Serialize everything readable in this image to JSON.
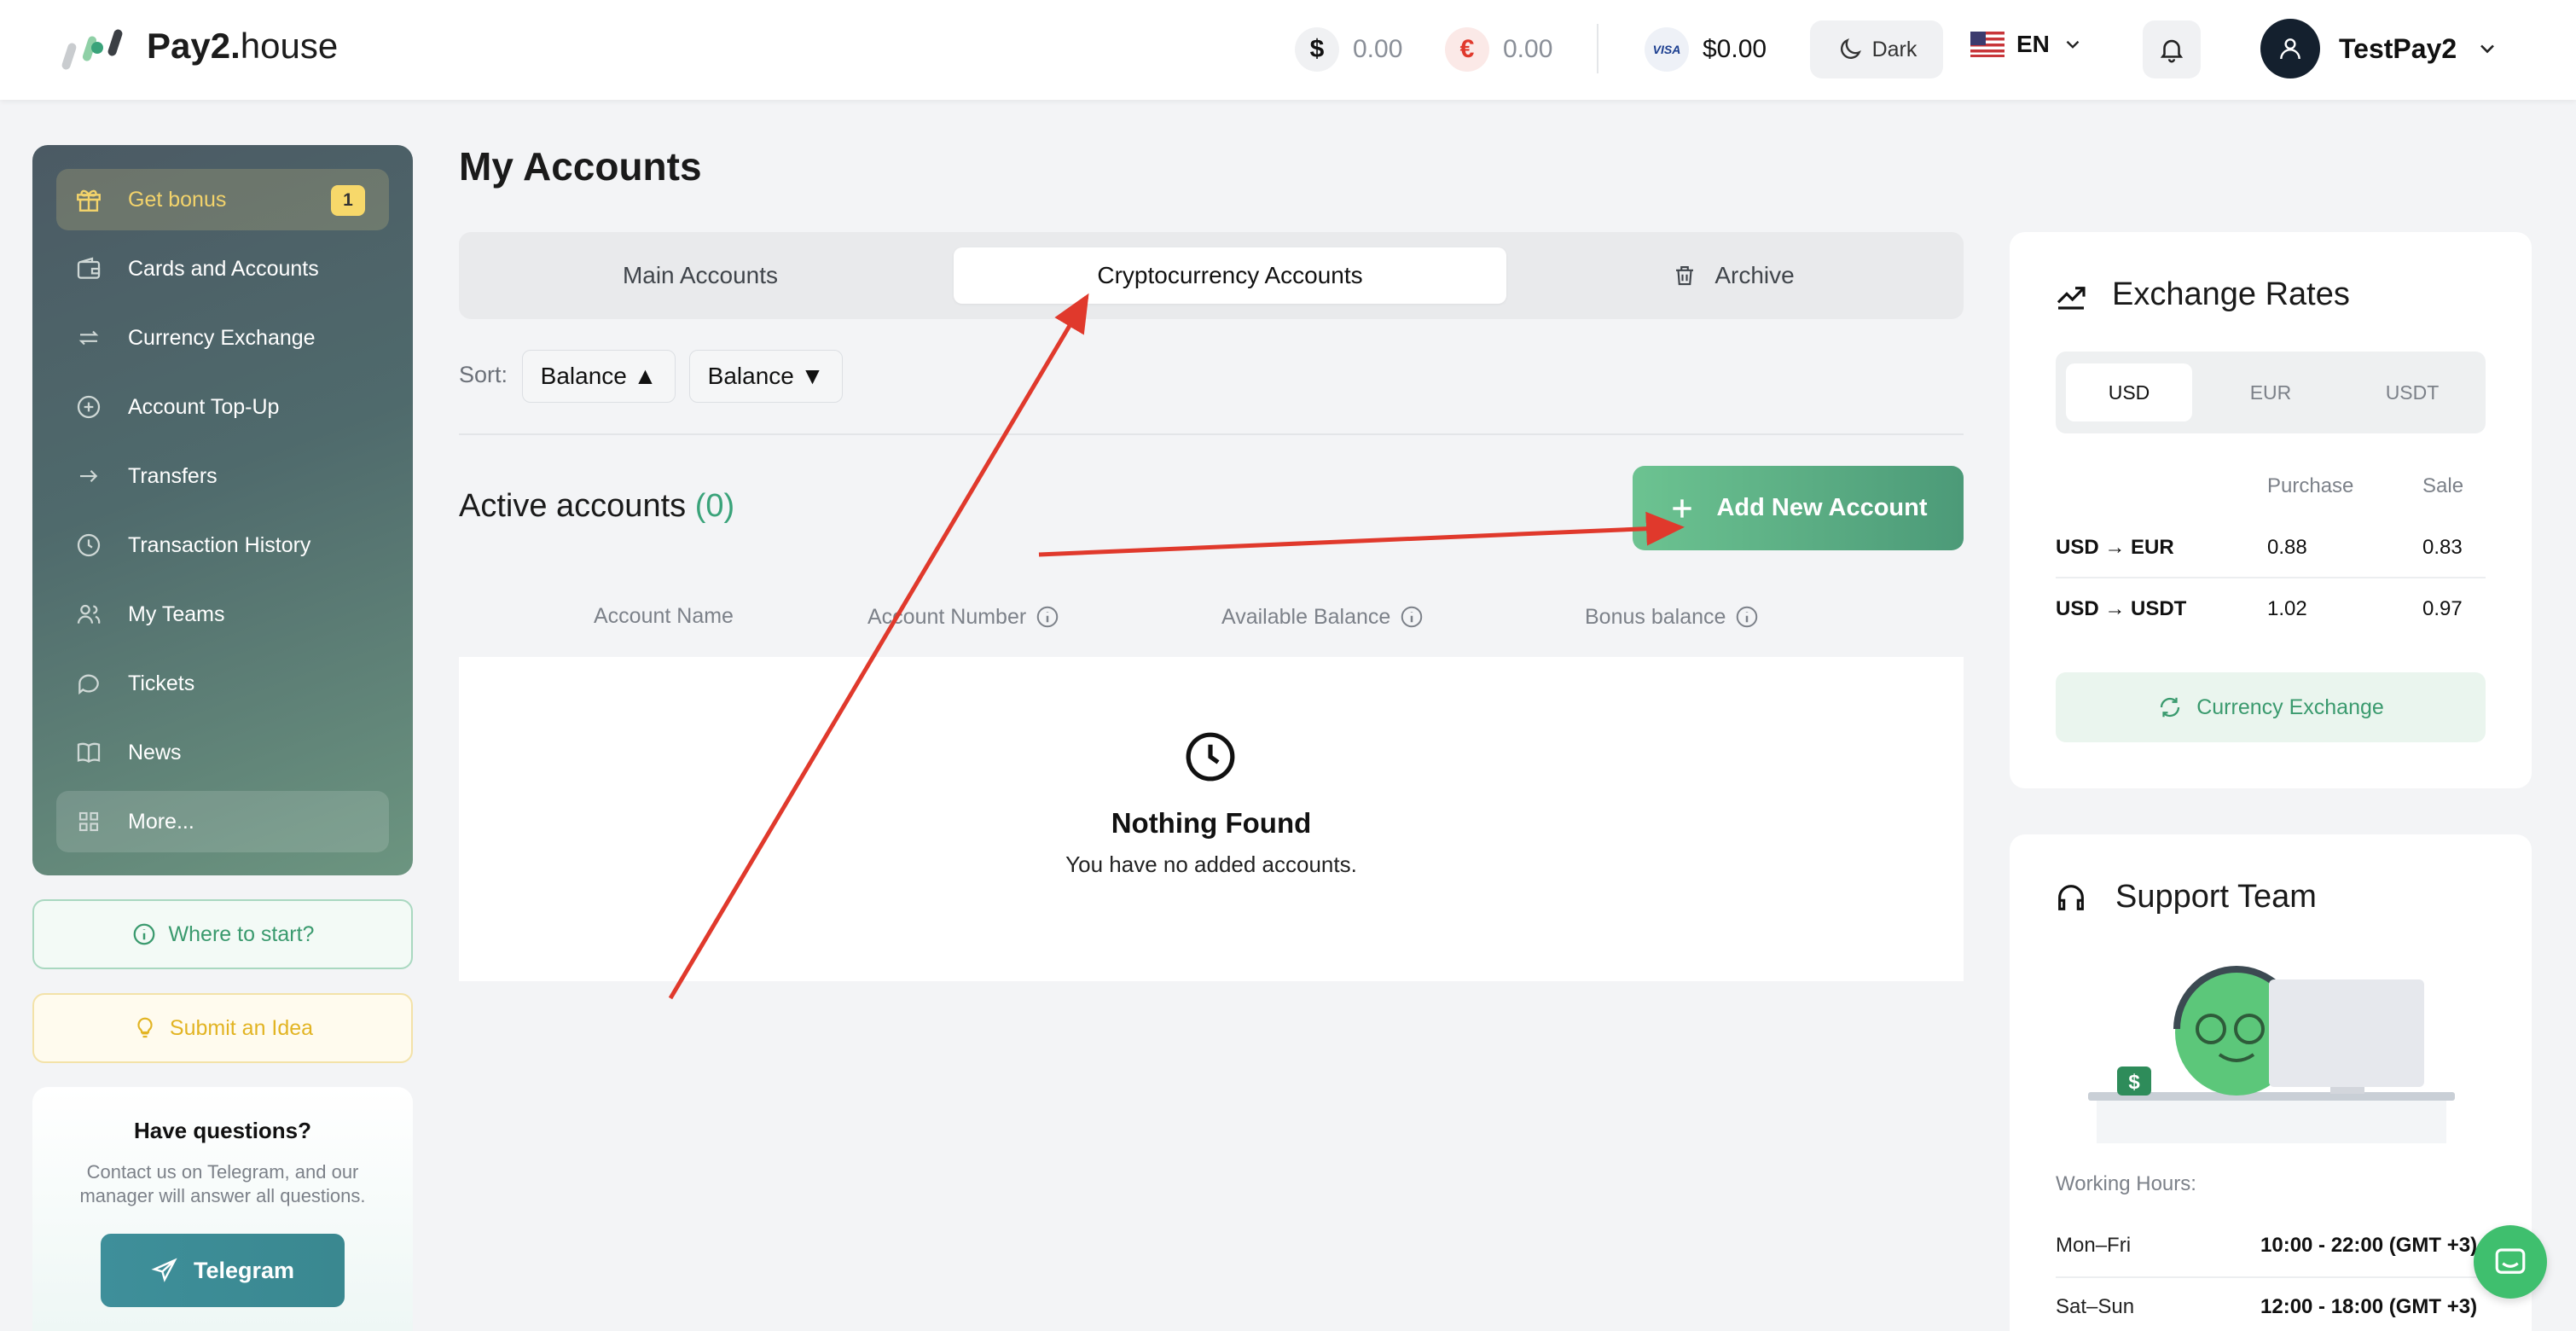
{
  "header": {
    "logo_bold": "Pay2.",
    "logo_light": "house",
    "balances": [
      {
        "symbol": "$",
        "value": "0.00"
      },
      {
        "symbol": "€",
        "value": "0.00"
      }
    ],
    "card_brand": "VISA",
    "card_balance": "$0.00",
    "theme_label": "Dark",
    "language": "EN",
    "username": "TestPay2"
  },
  "sidebar": {
    "items": [
      {
        "label": "Get bonus",
        "badge": "1"
      },
      {
        "label": "Cards and Accounts"
      },
      {
        "label": "Currency Exchange"
      },
      {
        "label": "Account Top-Up"
      },
      {
        "label": "Transfers"
      },
      {
        "label": "Transaction History"
      },
      {
        "label": "My Teams"
      },
      {
        "label": "Tickets"
      },
      {
        "label": "News"
      },
      {
        "label": "More..."
      }
    ],
    "where_to_start": "Where to start?",
    "submit_idea": "Submit an Idea",
    "questions_title": "Have questions?",
    "questions_text": "Contact us on Telegram, and our manager will answer all questions.",
    "telegram_label": "Telegram"
  },
  "main": {
    "title": "My Accounts",
    "tabs": [
      {
        "label": "Main Accounts"
      },
      {
        "label": "Cryptocurrency Accounts"
      },
      {
        "label": "Archive"
      }
    ],
    "sort_label": "Sort:",
    "sort_buttons": [
      "Balance ▲",
      "Balance ▼"
    ],
    "active_accounts_label": "Active accounts",
    "active_accounts_count": "(0)",
    "add_button": "Add New Account",
    "columns": [
      "Account Name",
      "Account Number",
      "Available Balance",
      "Bonus balance"
    ],
    "empty_title": "Nothing Found",
    "empty_text": "You have no added accounts."
  },
  "exchange": {
    "title": "Exchange Rates",
    "tabs": [
      "USD",
      "EUR",
      "USDT"
    ],
    "headers": {
      "purchase": "Purchase",
      "sale": "Sale"
    },
    "rows": [
      {
        "pair": "USD → EUR",
        "purchase": "0.88",
        "sale": "0.83"
      },
      {
        "pair": "USD → USDT",
        "purchase": "1.02",
        "sale": "0.97"
      }
    ],
    "button": "Currency Exchange"
  },
  "support": {
    "title": "Support Team",
    "hours_label": "Working Hours:",
    "hours": [
      {
        "days": "Mon–Fri",
        "time": "10:00 - 22:00 (GMT +3)"
      },
      {
        "days": "Sat–Sun",
        "time": "12:00 - 18:00 (GMT +3)"
      }
    ]
  },
  "colors": {
    "accent_green": "#3aa37a",
    "annotation_red": "#e0392c",
    "sidebar_active": "#f3d36b"
  }
}
